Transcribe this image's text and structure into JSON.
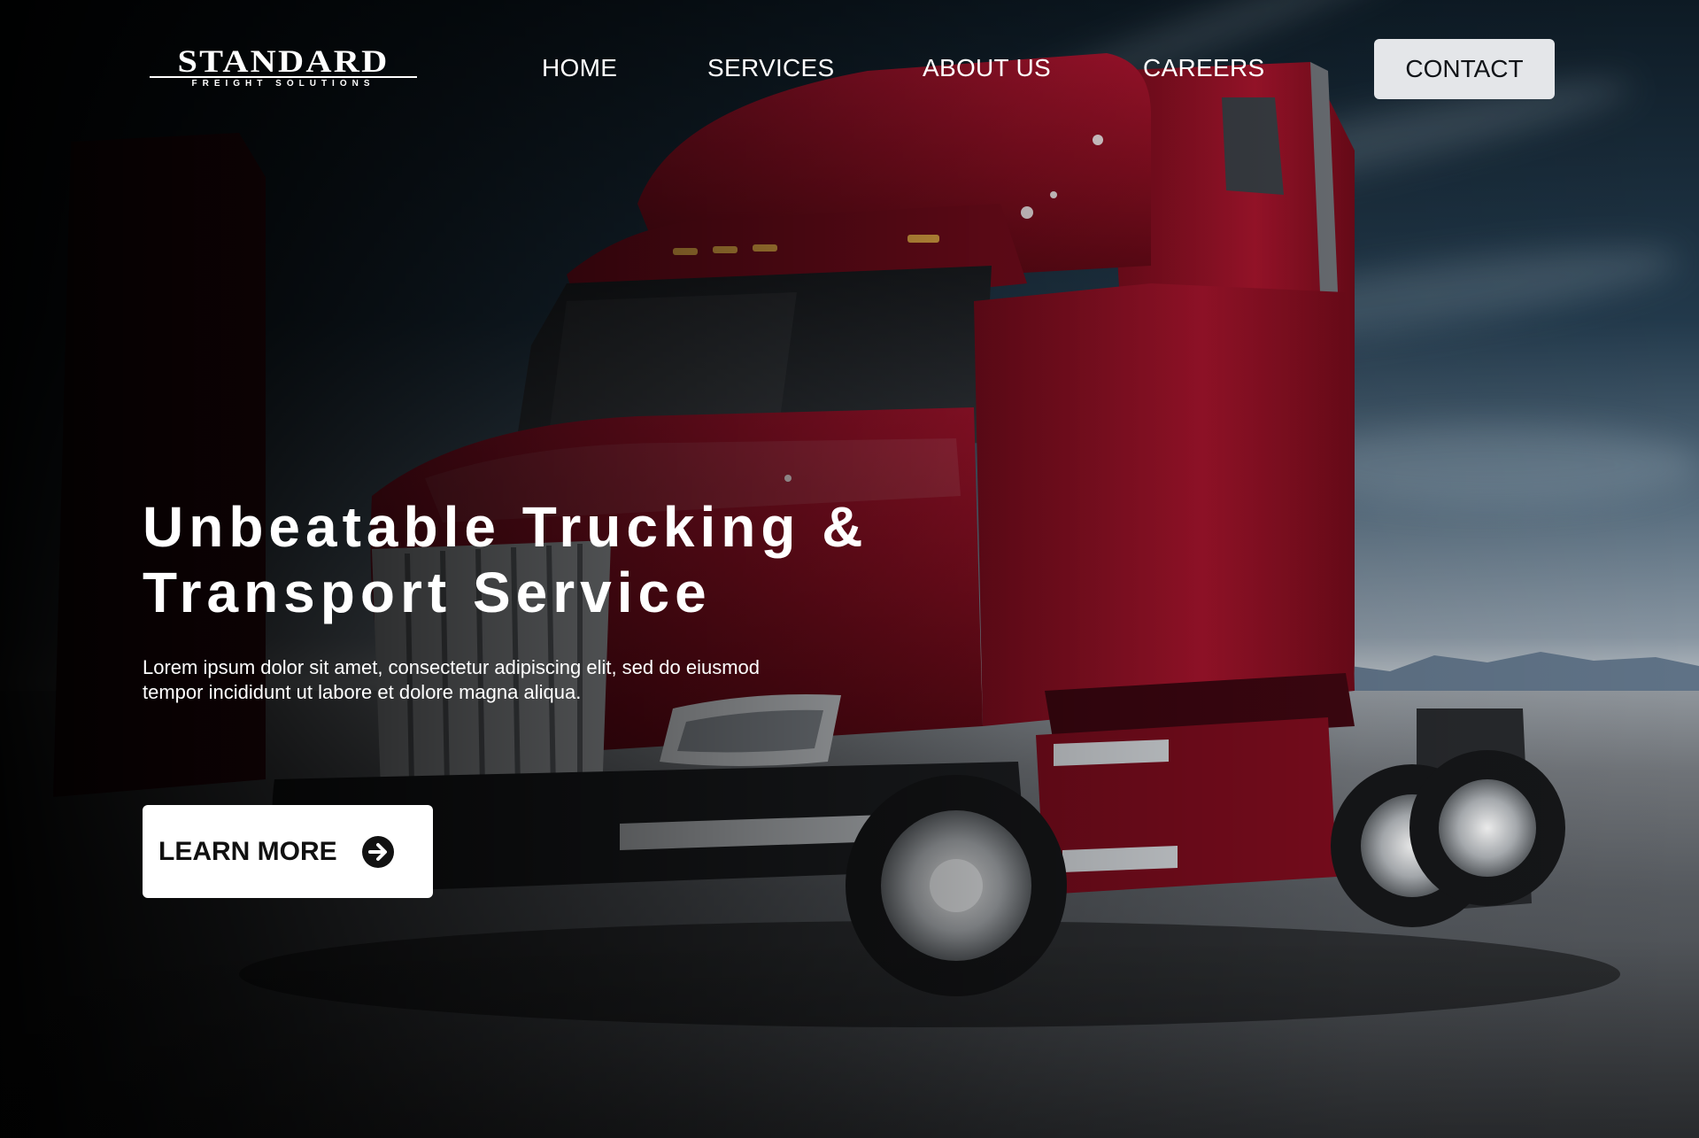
{
  "logo": {
    "name": "STANDARD",
    "tagline": "FREIGHT SOLUTIONS"
  },
  "nav": {
    "items": [
      {
        "label": "HOME"
      },
      {
        "label": "SERVICES"
      },
      {
        "label": "ABOUT US"
      },
      {
        "label": "CAREERS"
      }
    ],
    "contact_label": "CONTACT"
  },
  "hero": {
    "title_line1": "Unbeatable Trucking &",
    "title_line2": "Transport Service",
    "description": "Lorem ipsum dolor sit amet, consectetur adipiscing elit, sed do eiusmod tempor incididunt ut labore et dolore magna aliqua.",
    "cta_label": "LEARN MORE",
    "cta_icon": "arrow-right-circle-icon"
  },
  "colors": {
    "truck_red": "#8b0f22",
    "button_light": "#e4e6e9",
    "text_white": "#ffffff"
  }
}
